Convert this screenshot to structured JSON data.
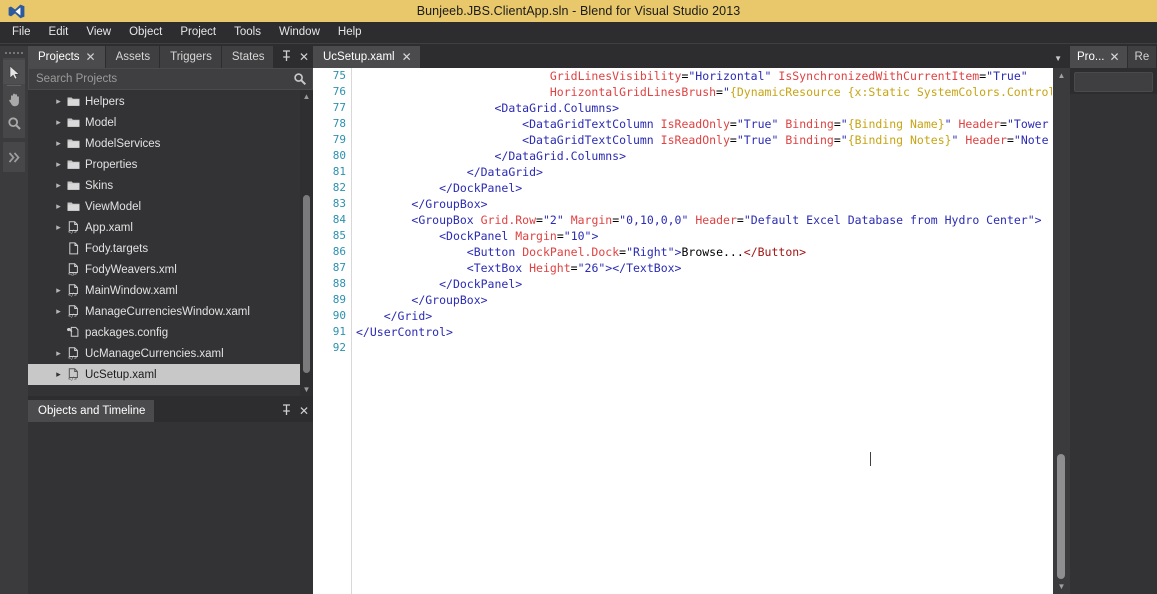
{
  "window": {
    "title": "Bunjeeb.JBS.ClientApp.sln - Blend for Visual Studio 2013",
    "logo_icon": "visual-studio-logo",
    "titlebar_color": "#e8c86a"
  },
  "menubar": {
    "items": [
      {
        "label": "File"
      },
      {
        "label": "Edit"
      },
      {
        "label": "View"
      },
      {
        "label": "Object"
      },
      {
        "label": "Project"
      },
      {
        "label": "Tools"
      },
      {
        "label": "Window"
      },
      {
        "label": "Help"
      }
    ]
  },
  "toolrail": {
    "grip_icon": "drag-grip-dots",
    "tools": [
      {
        "icon": "selection-arrow-icon",
        "selected": true
      },
      {
        "icon": "pan-hand-icon",
        "selected": false
      },
      {
        "icon": "zoom-magnifier-icon",
        "selected": false
      }
    ],
    "overflow": {
      "icon": "double-chevron-right-icon"
    }
  },
  "projects_panel": {
    "tabs": [
      {
        "label": "Projects",
        "active": true,
        "closable": true
      },
      {
        "label": "Assets",
        "active": false,
        "closable": false
      },
      {
        "label": "Triggers",
        "active": false,
        "closable": false
      },
      {
        "label": "States",
        "active": false,
        "closable": false
      }
    ],
    "tools": [
      {
        "icon": "pin-icon",
        "glyph": "╤"
      },
      {
        "icon": "close-icon",
        "glyph": "✕"
      }
    ],
    "search": {
      "placeholder": "Search Projects",
      "value": "",
      "icon": "search-icon"
    },
    "tree": [
      {
        "label": "Helpers",
        "icon": "folder-icon",
        "expandable": true,
        "indent": 1,
        "selected": false
      },
      {
        "label": "Model",
        "icon": "folder-icon",
        "expandable": true,
        "indent": 1,
        "selected": false
      },
      {
        "label": "ModelServices",
        "icon": "folder-icon",
        "expandable": true,
        "indent": 1,
        "selected": false
      },
      {
        "label": "Properties",
        "icon": "folder-icon",
        "expandable": true,
        "indent": 1,
        "selected": false
      },
      {
        "label": "Skins",
        "icon": "folder-icon",
        "expandable": true,
        "indent": 1,
        "selected": false
      },
      {
        "label": "ViewModel",
        "icon": "folder-icon",
        "expandable": true,
        "indent": 1,
        "selected": false
      },
      {
        "label": "App.xaml",
        "icon": "xaml-file-icon",
        "expandable": true,
        "indent": 1,
        "selected": false
      },
      {
        "label": "Fody.targets",
        "icon": "blank-file-icon",
        "expandable": false,
        "indent": 1,
        "selected": false
      },
      {
        "label": "FodyWeavers.xml",
        "icon": "xml-file-icon",
        "expandable": false,
        "indent": 1,
        "selected": false
      },
      {
        "label": "MainWindow.xaml",
        "icon": "xaml-file-icon",
        "expandable": true,
        "indent": 1,
        "selected": false
      },
      {
        "label": "ManageCurrenciesWindow.xaml",
        "icon": "xaml-file-icon",
        "expandable": true,
        "indent": 1,
        "selected": false
      },
      {
        "label": "packages.config",
        "icon": "config-file-icon",
        "expandable": false,
        "indent": 1,
        "selected": false
      },
      {
        "label": "UcManageCurrencies.xaml",
        "icon": "xaml-file-icon",
        "expandable": true,
        "indent": 1,
        "selected": false
      },
      {
        "label": "UcSetup.xaml",
        "icon": "xaml-file-icon",
        "expandable": true,
        "indent": 1,
        "selected": true
      }
    ],
    "scrollbar": {
      "up_glyph": "▲",
      "down_glyph": "▼"
    }
  },
  "objects_panel": {
    "tabs": [
      {
        "label": "Objects and Timeline",
        "active": true,
        "closable": false
      }
    ],
    "tools": [
      {
        "icon": "pin-icon",
        "glyph": "╤"
      },
      {
        "icon": "close-icon",
        "glyph": "✕"
      }
    ]
  },
  "editor": {
    "tab": {
      "label": "UcSetup.xaml",
      "close_glyph": "✕"
    },
    "overflow_icon": "chevron-down-icon",
    "first_line_number": 75,
    "line_numbers": [
      75,
      76,
      77,
      78,
      79,
      80,
      81,
      82,
      83,
      84,
      85,
      86,
      87,
      88,
      89,
      90,
      91,
      92
    ],
    "lines": [
      {
        "n": 75,
        "tokens": [
          {
            "t": "plain",
            "s": "                            "
          },
          {
            "t": "attr",
            "s": "GridLinesVisibility"
          },
          {
            "t": "plain",
            "s": "="
          },
          {
            "t": "val",
            "s": "\"Horizontal\""
          },
          {
            "t": "plain",
            "s": " "
          },
          {
            "t": "attr",
            "s": "IsSynchronizedWithCurrentItem"
          },
          {
            "t": "plain",
            "s": "="
          },
          {
            "t": "val",
            "s": "\"True\""
          }
        ]
      },
      {
        "n": 76,
        "tokens": [
          {
            "t": "plain",
            "s": "                            "
          },
          {
            "t": "attr",
            "s": "HorizontalGridLinesBrush"
          },
          {
            "t": "plain",
            "s": "="
          },
          {
            "t": "val",
            "s": "\""
          },
          {
            "t": "mk",
            "s": "{DynamicResource {x:Static SystemColors.ControlD"
          }
        ]
      },
      {
        "n": 77,
        "tokens": [
          {
            "t": "plain",
            "s": "                    "
          },
          {
            "t": "tag",
            "s": "<DataGrid.Columns>"
          }
        ]
      },
      {
        "n": 78,
        "tokens": [
          {
            "t": "plain",
            "s": "                        "
          },
          {
            "t": "tag",
            "s": "<DataGridTextColumn"
          },
          {
            "t": "plain",
            "s": " "
          },
          {
            "t": "attr",
            "s": "IsReadOnly"
          },
          {
            "t": "plain",
            "s": "="
          },
          {
            "t": "val",
            "s": "\"True\""
          },
          {
            "t": "plain",
            "s": " "
          },
          {
            "t": "attr",
            "s": "Binding"
          },
          {
            "t": "plain",
            "s": "="
          },
          {
            "t": "val",
            "s": "\""
          },
          {
            "t": "mk",
            "s": "{Binding Name}"
          },
          {
            "t": "val",
            "s": "\""
          },
          {
            "t": "plain",
            "s": " "
          },
          {
            "t": "attr",
            "s": "Header"
          },
          {
            "t": "plain",
            "s": "="
          },
          {
            "t": "val",
            "s": "\"Tower"
          }
        ]
      },
      {
        "n": 79,
        "tokens": [
          {
            "t": "plain",
            "s": "                        "
          },
          {
            "t": "tag",
            "s": "<DataGridTextColumn"
          },
          {
            "t": "plain",
            "s": " "
          },
          {
            "t": "attr",
            "s": "IsReadOnly"
          },
          {
            "t": "plain",
            "s": "="
          },
          {
            "t": "val",
            "s": "\"True\""
          },
          {
            "t": "plain",
            "s": " "
          },
          {
            "t": "attr",
            "s": "Binding"
          },
          {
            "t": "plain",
            "s": "="
          },
          {
            "t": "val",
            "s": "\""
          },
          {
            "t": "mk",
            "s": "{Binding Notes}"
          },
          {
            "t": "val",
            "s": "\""
          },
          {
            "t": "plain",
            "s": " "
          },
          {
            "t": "attr",
            "s": "Header"
          },
          {
            "t": "plain",
            "s": "="
          },
          {
            "t": "val",
            "s": "\"Note"
          }
        ]
      },
      {
        "n": 80,
        "tokens": [
          {
            "t": "plain",
            "s": "                    "
          },
          {
            "t": "tag",
            "s": "</DataGrid.Columns>"
          }
        ]
      },
      {
        "n": 81,
        "tokens": [
          {
            "t": "plain",
            "s": "                "
          },
          {
            "t": "tag",
            "s": "</DataGrid>"
          }
        ]
      },
      {
        "n": 82,
        "tokens": [
          {
            "t": "plain",
            "s": "            "
          },
          {
            "t": "tag",
            "s": "</DockPanel>"
          }
        ]
      },
      {
        "n": 83,
        "tokens": [
          {
            "t": "plain",
            "s": "        "
          },
          {
            "t": "tag",
            "s": "</GroupBox>"
          }
        ]
      },
      {
        "n": 84,
        "tokens": [
          {
            "t": "plain",
            "s": "        "
          },
          {
            "t": "tag",
            "s": "<GroupBox"
          },
          {
            "t": "plain",
            "s": " "
          },
          {
            "t": "attr",
            "s": "Grid.Row"
          },
          {
            "t": "plain",
            "s": "="
          },
          {
            "t": "val",
            "s": "\"2\""
          },
          {
            "t": "plain",
            "s": " "
          },
          {
            "t": "attr",
            "s": "Margin"
          },
          {
            "t": "plain",
            "s": "="
          },
          {
            "t": "val",
            "s": "\"0,10,0,0\""
          },
          {
            "t": "plain",
            "s": " "
          },
          {
            "t": "attr",
            "s": "Header"
          },
          {
            "t": "plain",
            "s": "="
          },
          {
            "t": "val",
            "s": "\"Default Excel Database from Hydro Center\""
          },
          {
            "t": "tag",
            "s": ">"
          }
        ]
      },
      {
        "n": 85,
        "tokens": [
          {
            "t": "plain",
            "s": "            "
          },
          {
            "t": "tag",
            "s": "<DockPanel"
          },
          {
            "t": "plain",
            "s": " "
          },
          {
            "t": "attr",
            "s": "Margin"
          },
          {
            "t": "plain",
            "s": "="
          },
          {
            "t": "val",
            "s": "\"10\""
          },
          {
            "t": "tag",
            "s": ">"
          }
        ]
      },
      {
        "n": 86,
        "tokens": [
          {
            "t": "plain",
            "s": "                "
          },
          {
            "t": "tag",
            "s": "<Button"
          },
          {
            "t": "plain",
            "s": " "
          },
          {
            "t": "attr",
            "s": "DockPanel.Dock"
          },
          {
            "t": "plain",
            "s": "="
          },
          {
            "t": "val",
            "s": "\"Right\""
          },
          {
            "t": "tag",
            "s": ">"
          },
          {
            "t": "txt",
            "s": "Browse..."
          },
          {
            "t": "tag2",
            "s": "</Button>"
          }
        ]
      },
      {
        "n": 87,
        "tokens": [
          {
            "t": "plain",
            "s": "                "
          },
          {
            "t": "tag",
            "s": "<TextBox"
          },
          {
            "t": "plain",
            "s": " "
          },
          {
            "t": "attr",
            "s": "Height"
          },
          {
            "t": "plain",
            "s": "="
          },
          {
            "t": "val",
            "s": "\"26\""
          },
          {
            "t": "tag",
            "s": ">"
          },
          {
            "t": "tag",
            "s": "</TextBox>"
          }
        ]
      },
      {
        "n": 88,
        "tokens": [
          {
            "t": "plain",
            "s": "            "
          },
          {
            "t": "tag",
            "s": "</DockPanel>"
          }
        ]
      },
      {
        "n": 89,
        "tokens": [
          {
            "t": "plain",
            "s": "        "
          },
          {
            "t": "tag",
            "s": "</GroupBox>"
          }
        ]
      },
      {
        "n": 90,
        "tokens": [
          {
            "t": "plain",
            "s": "    "
          },
          {
            "t": "tag",
            "s": "</Grid>"
          }
        ]
      },
      {
        "n": 91,
        "tokens": [
          {
            "t": "tag",
            "s": "</UserControl>"
          }
        ]
      },
      {
        "n": 92,
        "tokens": []
      }
    ],
    "syntax_colors": {
      "line_number": "#2b91af",
      "tag": "#2b2bb5",
      "tag_alt": "#a31515",
      "attribute": "#e04242",
      "value": "#2b2bb5",
      "markup_extension": "#c8a415",
      "text": "#000000",
      "background": "#ffffff"
    },
    "scrollbar": {
      "up_glyph": "▲",
      "down_glyph": "▼"
    }
  },
  "right_panel": {
    "tabs": [
      {
        "label": "Pro...",
        "active": true,
        "closable": true
      },
      {
        "label": "Re",
        "active": false,
        "closable": false
      }
    ],
    "search": {
      "placeholder": "",
      "value": ""
    }
  }
}
